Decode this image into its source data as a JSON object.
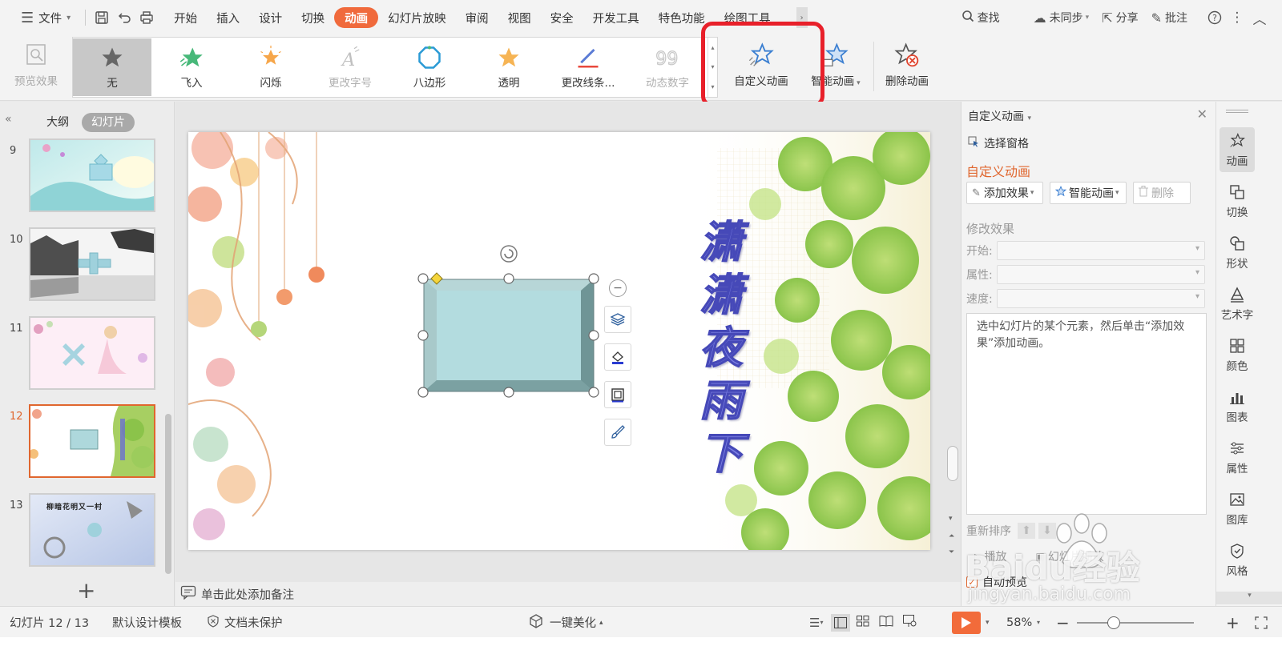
{
  "menubar": {
    "file": "文件",
    "tabs": [
      "开始",
      "插入",
      "设计",
      "切换",
      "动画",
      "幻灯片放映",
      "审阅",
      "视图",
      "安全",
      "开发工具",
      "特色功能",
      "绘图工具"
    ],
    "active_tab": "动画",
    "search": "查找",
    "sync": "未同步",
    "share": "分享",
    "comment": "批注"
  },
  "ribbon": {
    "preview": "预览效果",
    "gallery": [
      "无",
      "飞入",
      "闪烁",
      "更改字号",
      "八边形",
      "透明",
      "更改线条...",
      "动态数字"
    ],
    "custom_animation": "自定义动画",
    "smart_animation": "智能动画",
    "delete_animation": "删除动画"
  },
  "left_panel": {
    "tab_outline": "大纲",
    "tab_slides": "幻灯片",
    "thumbnails": [
      {
        "num": "9"
      },
      {
        "num": "10"
      },
      {
        "num": "11"
      },
      {
        "num": "12"
      },
      {
        "num": "13",
        "title": "柳暗花明又一村"
      }
    ],
    "active_slide": "12"
  },
  "slide": {
    "vertical_title": "潇潇夜雨下"
  },
  "notes": {
    "placeholder": "单击此处添加备注"
  },
  "taskpane": {
    "title": "自定义动画",
    "selection_pane": "选择窗格",
    "heading": "自定义动画",
    "add_effect": "添加效果",
    "smart_animation": "智能动画",
    "delete": "删除",
    "modify_section": "修改效果",
    "start_label": "开始:",
    "property_label": "属性:",
    "speed_label": "速度:",
    "hint": "选中幻灯片的某个元素，然后单击“添加效果”添加动画。",
    "reorder": "重新排序",
    "play_label": "播放",
    "slideshow_label": "幻灯片播放",
    "auto_preview": "自动预览"
  },
  "sidebar": {
    "items": [
      "动画",
      "切换",
      "形状",
      "艺术字",
      "颜色",
      "图表",
      "属性",
      "图库",
      "风格"
    ]
  },
  "statusbar": {
    "slide_counter": "幻灯片 12 / 13",
    "template": "默认设计模板",
    "protection": "文档未保护",
    "beautify": "一键美化",
    "zoom": "58%"
  },
  "watermark": {
    "brand": "Baidu经验",
    "url": "jingyan.baidu.com"
  },
  "colors": {
    "accent": "#f06a3c",
    "highlight_box": "#e8202a",
    "active_slide_border": "#e0662e"
  }
}
